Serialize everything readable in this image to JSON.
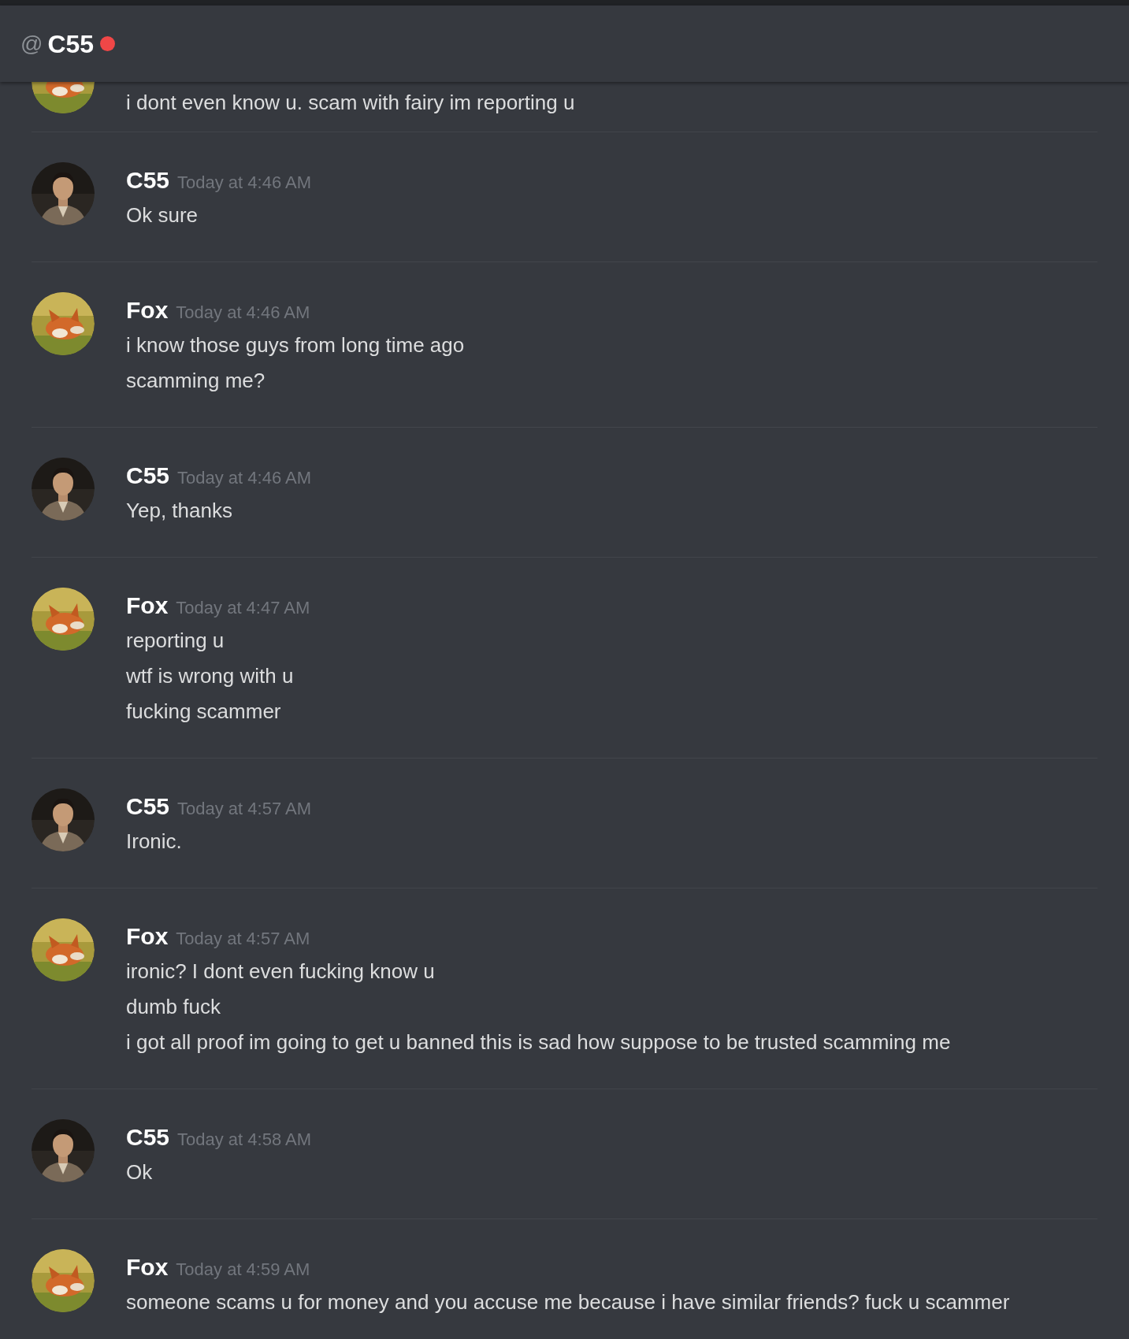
{
  "header": {
    "symbol": "@",
    "name": "C55",
    "color": "#f04747"
  },
  "cut_message": {
    "kind": "fox",
    "text": "i dont even know u. scam with fairy im reporting u"
  },
  "messages": [
    {
      "kind": "c55",
      "author": "C55",
      "time": "Today at 4:46 AM",
      "lines": [
        "Ok sure"
      ]
    },
    {
      "kind": "fox",
      "author": "Fox",
      "time": "Today at 4:46 AM",
      "lines": [
        "i know those guys from long time ago",
        "scamming me?"
      ]
    },
    {
      "kind": "c55",
      "author": "C55",
      "time": "Today at 4:46 AM",
      "lines": [
        "Yep, thanks"
      ]
    },
    {
      "kind": "fox",
      "author": "Fox",
      "time": "Today at 4:47 AM",
      "lines": [
        "reporting u",
        "wtf is wrong with u",
        "fucking scammer"
      ]
    },
    {
      "kind": "c55",
      "author": "C55",
      "time": "Today at 4:57 AM",
      "lines": [
        "Ironic."
      ]
    },
    {
      "kind": "fox",
      "author": "Fox",
      "time": "Today at 4:57 AM",
      "lines": [
        "ironic? I dont even fucking know u",
        "dumb fuck",
        "i got all proof im going to get u banned this is sad how suppose to be trusted scamming me"
      ]
    },
    {
      "kind": "c55",
      "author": "C55",
      "time": "Today at 4:58 AM",
      "lines": [
        "Ok"
      ]
    },
    {
      "kind": "fox",
      "author": "Fox",
      "time": "Today at 4:59 AM",
      "lines": [
        "someone scams u for money and you accuse me because i have similar friends? fuck u scammer"
      ]
    }
  ]
}
